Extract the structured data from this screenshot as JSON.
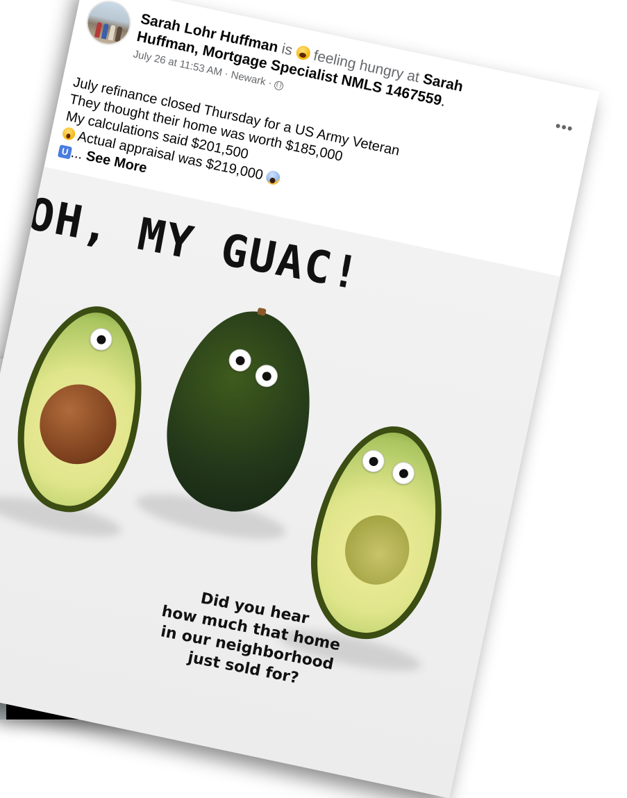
{
  "background_post": {
    "more_label": "•••",
    "emojis": [
      "laugh-cry-emoji",
      "laugh-cry-emoji",
      "laugh-cry-emoji"
    ]
  },
  "post": {
    "author": "Sarah Lohr Huffman",
    "is_word": "is",
    "feeling": "feeling hungry at",
    "place_line1": "Sarah",
    "place_line2": "Huffman, Mortgage Specialist NMLS 1467559",
    "period": ".",
    "timestamp": "July 26 at 11:53 AM",
    "separator": "·",
    "location": "Newark",
    "more_label": "•••",
    "lines": [
      "July refinance closed Thursday for a US Army Veteran",
      "They thought their home was worth $185,000",
      "My calculations said $201,500",
      "Actual appraisal was $219,000"
    ],
    "u_icon": "U",
    "ellipsis": "...",
    "see_more": "See More",
    "image": {
      "title": "OH, MY GUAC!",
      "caption": [
        "Did you hear",
        "how much that home",
        "in our neighborhood",
        "just sold for?"
      ]
    }
  }
}
